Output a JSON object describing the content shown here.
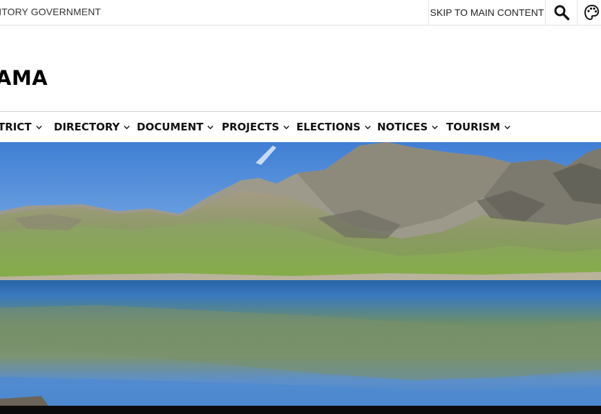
{
  "header": {
    "gov_text": "RITORY GOVERNMENT",
    "skip_link": "SKIP TO MAIN CONTENT",
    "search_icon": "search-icon",
    "accessibility_icon": "accessibility-icon"
  },
  "site": {
    "title": "AMA"
  },
  "nav": {
    "items": [
      {
        "label": "TRICT"
      },
      {
        "label": "DIRECTORY"
      },
      {
        "label": "DOCUMENT"
      },
      {
        "label": "PROJECTS"
      },
      {
        "label": "ELECTIONS"
      },
      {
        "label": "NOTICES"
      },
      {
        "label": "TOURISM"
      }
    ],
    "chevron_icon": "chevron-down-icon"
  },
  "hero": {
    "image": "mountain-lake-banner"
  },
  "colors": {
    "sky": "#5b8fd6",
    "lake": "#2f74b8",
    "text": "#111111"
  }
}
